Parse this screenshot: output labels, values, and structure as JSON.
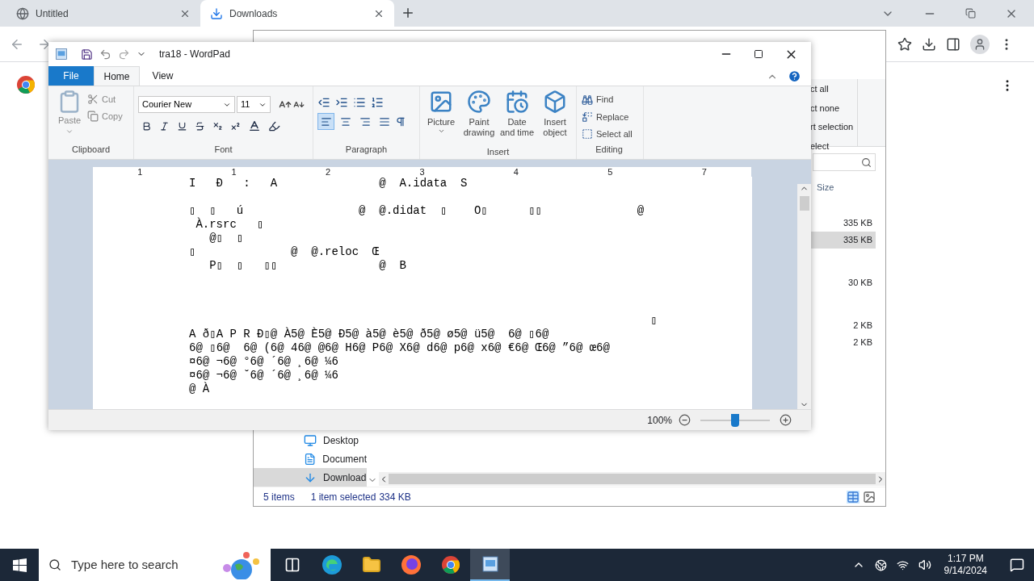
{
  "browser": {
    "tabs": [
      {
        "title": "Untitled",
        "selected": false
      },
      {
        "title": "Downloads",
        "selected": true
      }
    ]
  },
  "explorer": {
    "ribbon_items": [
      "ct all",
      "ct none",
      "rt selection",
      "elect"
    ],
    "size_header": "Size",
    "file_groups": [
      [
        {
          "size": "335 KB",
          "selected": false
        },
        {
          "size": "335 KB",
          "selected": true
        }
      ],
      [
        {
          "size": "30 KB",
          "selected": false
        }
      ],
      [
        {
          "size": "2 KB",
          "selected": false
        },
        {
          "size": "2 KB",
          "selected": false
        }
      ]
    ],
    "nav": [
      {
        "label": "Desktop",
        "kind": "desktop",
        "selected": false
      },
      {
        "label": "Document",
        "kind": "document",
        "selected": false
      },
      {
        "label": "Download",
        "kind": "download",
        "selected": true
      }
    ],
    "status": [
      "5 items",
      "1 item selected",
      "334 KB"
    ]
  },
  "wordpad": {
    "title": "tra18 - WordPad",
    "tabs": [
      {
        "label": "File",
        "kind": "file",
        "selected": false
      },
      {
        "label": "Home",
        "kind": "tab",
        "selected": true
      },
      {
        "label": "View",
        "kind": "tab",
        "selected": false
      }
    ],
    "clipboard": {
      "paste": "Paste",
      "cut": "Cut",
      "copy": "Copy",
      "label": "Clipboard"
    },
    "font": {
      "name": "Courier New",
      "size": "11",
      "label": "Font"
    },
    "paragraph": {
      "label": "Paragraph",
      "alignments": [
        {
          "kind": "left",
          "selected": true
        },
        {
          "kind": "center",
          "selected": false
        },
        {
          "kind": "right",
          "selected": false
        },
        {
          "kind": "justify",
          "selected": false
        }
      ]
    },
    "insert": {
      "label": "Insert",
      "items": [
        {
          "kind": "picture",
          "label": "Picture",
          "has_menu": true
        },
        {
          "kind": "paint",
          "label": "Paint drawing",
          "has_menu": false
        },
        {
          "kind": "datetime",
          "label": "Date and time",
          "has_menu": false
        },
        {
          "kind": "object",
          "label": "Insert object",
          "has_menu": false
        }
      ]
    },
    "editing": {
      "label": "Editing",
      "items": [
        {
          "kind": "find",
          "label": "Find"
        },
        {
          "kind": "replace",
          "label": "Replace"
        },
        {
          "kind": "selectall",
          "label": "Select all"
        }
      ]
    },
    "ruler": [
      "1",
      "1",
      "2",
      "3",
      "4",
      "5",
      "7"
    ],
    "document_blocks": [
      [
        "I   Ð   :   A               @  A.idata  S"
      ],
      [
        "▯  ▯   ú                 @  @.didat  ▯    O▯      ▯▯              @",
        " À.rsrc   ▯",
        "   @▯  ▯",
        "▯              @  @.reloc  Œ",
        "   P▯  ▯   ▯▯               @  B"
      ],
      [
        "                                                                    ▯",
        "A ð▯A P R Ð▯@ À5@ È5@ Ð5@ à5@ è5@ ð5@ ø5@ ü5@  6@ ▯6@",
        "6@ ▯6@  6@ (6@ 46@ @6@ H6@ P6@ X6@ d6@ p6@ x6@ €6@ Œ6@ ”6@ œ6@",
        "¤6@ ¬6@ °6@ ´6@ ¸6@ ¼6",
        "¤6@ ¬6@ ˘6@ ´6@ ¸6@ ¼6",
        "@ À"
      ]
    ],
    "zoom": {
      "reading": "100%",
      "level": 0.5
    }
  },
  "taskbar": {
    "search_placeholder": "Type here to search",
    "apps": [
      {
        "kind": "taskview",
        "selected": false
      },
      {
        "kind": "edge",
        "selected": false
      },
      {
        "kind": "explorer",
        "selected": false
      },
      {
        "kind": "firefox",
        "selected": false
      },
      {
        "kind": "chrome",
        "selected": false
      },
      {
        "kind": "wordpad",
        "selected": true
      }
    ],
    "time": "1:17 PM",
    "date": "9/14/2024"
  }
}
